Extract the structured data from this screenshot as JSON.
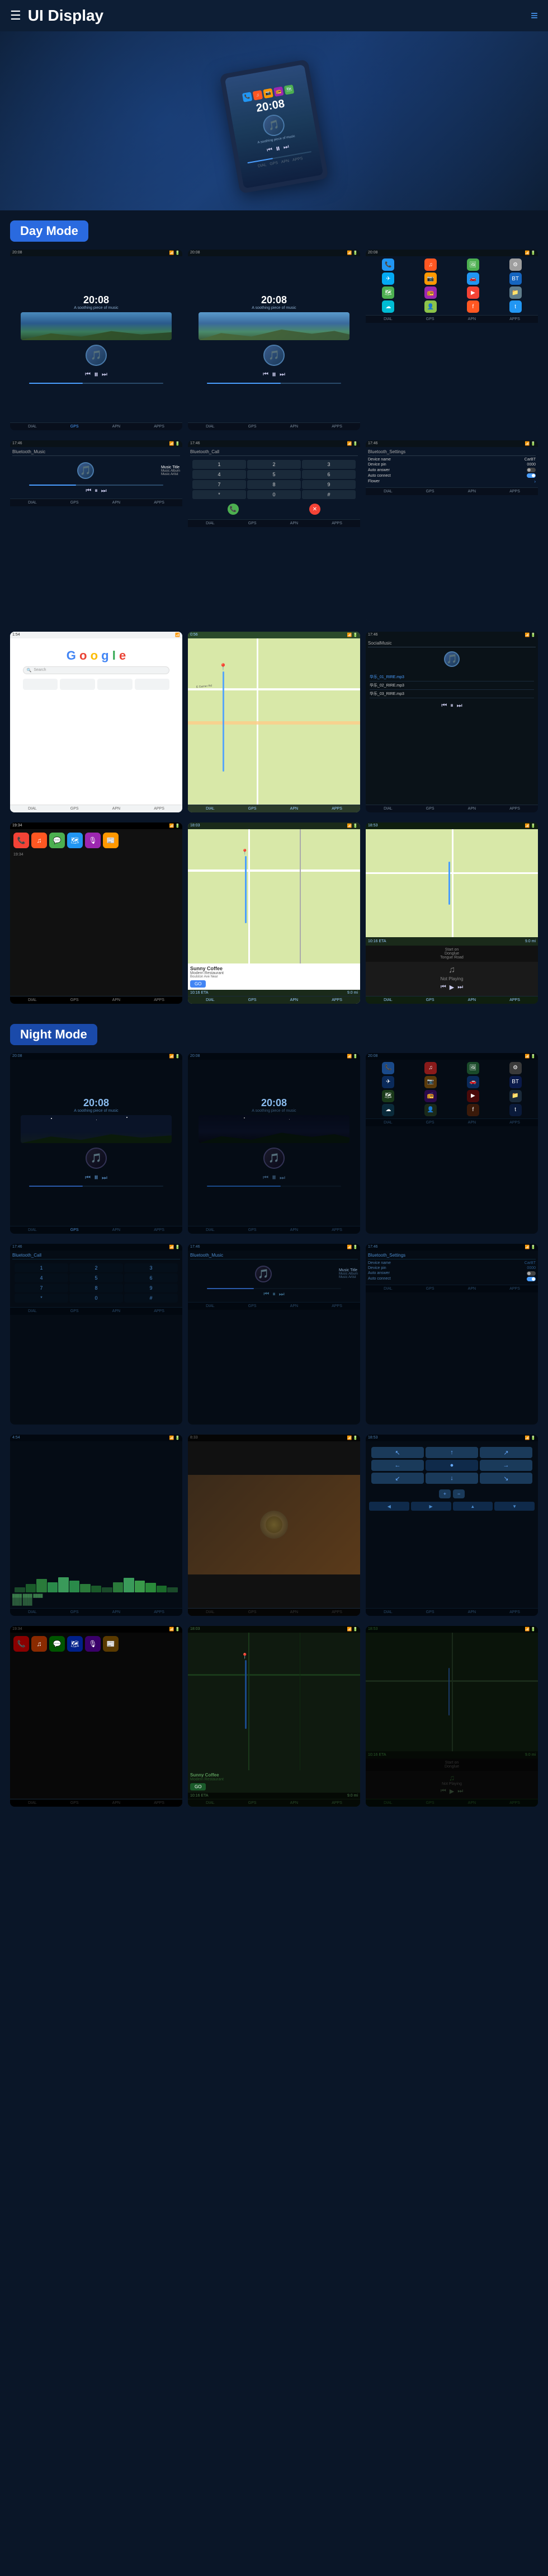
{
  "header": {
    "menu_icon": "☰",
    "title": "UI Display",
    "nav_icon": "≡"
  },
  "sections": {
    "day_mode": "Day Mode",
    "night_mode": "Night Mode"
  },
  "screens": {
    "time": "20:08",
    "subtitle": "A soothing piece of music",
    "music_title": "Music Title",
    "music_album": "Music Album",
    "music_artist": "Music Artist",
    "bluetooth_music": "Bluetooth_Music",
    "bluetooth_call": "Bluetooth_Call",
    "bluetooth_settings": "Bluetooth_Settings",
    "google": "Google",
    "social_music": "SocialMusic",
    "device_name_label": "Device name",
    "device_name_val": "CarBT",
    "device_pin_label": "Device pin",
    "device_pin_val": "0000",
    "auto_answer_label": "Auto answer",
    "auto_connect_label": "Auto connect",
    "flower_label": "Flower",
    "sunny_coffee": "Sunny Coffee",
    "modern_restaurant": "Modern Restaurant",
    "restaurant_addr": "Boulston Ave Near",
    "go_btn": "GO",
    "eta_label": "10:16 ETA",
    "distance": "9.0 mi",
    "eta_time": "10:16 ETA",
    "not_playing": "Not Playing",
    "start_on": "Start on",
    "donglue": "Donglue",
    "tongue_road": "Tongue Road",
    "track1": "华乐_01_RIRE.mp3",
    "track2": "华乐_02_RIRE.mp3",
    "track3": "华乐_03_RIRE.mp3",
    "carplay_time1": "19:34",
    "carplay_time2": "18:03",
    "nav_items": [
      "DIAL",
      "GPS",
      "APN",
      "APPS"
    ],
    "bottom_nav": [
      "DIAL",
      "GPS",
      "APN",
      "APPS"
    ],
    "app_colors": {
      "phone": "#2196F3",
      "music": "#FF5722",
      "maps": "#4CAF50",
      "settings": "#9E9E9E",
      "messages": "#4CAF50",
      "camera": "#FF9800",
      "radio": "#9C27B0",
      "bt": "#2196F3"
    }
  }
}
